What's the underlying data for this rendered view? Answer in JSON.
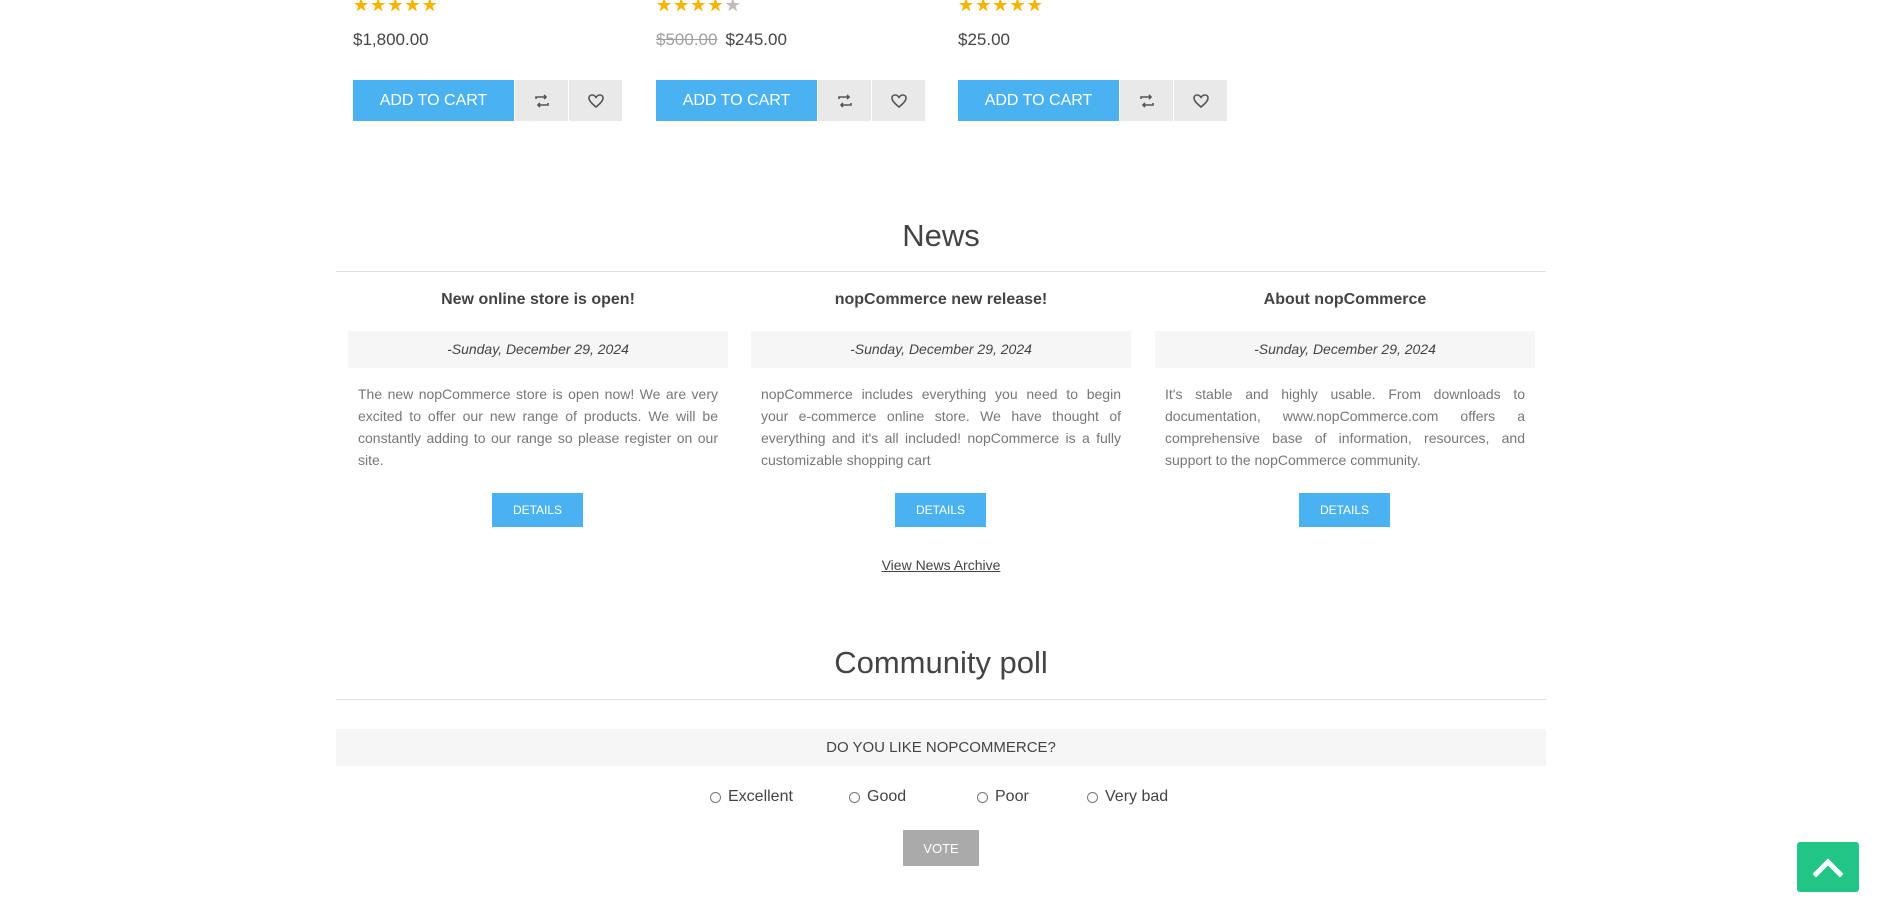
{
  "products": [
    {
      "rating": 5,
      "old_price": "",
      "price": "$1,800.00",
      "add_to_cart_label": "ADD TO CART"
    },
    {
      "rating": 4,
      "old_price": "$500.00",
      "price": "$245.00",
      "add_to_cart_label": "ADD TO CART"
    },
    {
      "rating": 5,
      "old_price": "",
      "price": "$25.00",
      "add_to_cart_label": "ADD TO CART"
    }
  ],
  "news": {
    "title": "News",
    "items": [
      {
        "title": "New online store is open!",
        "date": "-Sunday, December 29, 2024",
        "body": "The new nopCommerce store is open now! We are very excited to offer our new range of products. We will be constantly adding to our range so please register on our site.",
        "details_label": "DETAILS"
      },
      {
        "title": "nopCommerce new release!",
        "date": "-Sunday, December 29, 2024",
        "body": "nopCommerce includes everything you need to begin your e-commerce online store. We have thought of everything and it's all included! nopCommerce is a fully customizable shopping cart",
        "details_label": "DETAILS"
      },
      {
        "title": "About nopCommerce",
        "date": "-Sunday, December 29, 2024",
        "body": "It's stable and highly usable. From downloads to documentation, www.nopCommerce.com offers a comprehensive base of information, resources, and support to the nopCommerce community.",
        "details_label": "DETAILS"
      }
    ],
    "archive_link": "View News Archive"
  },
  "poll": {
    "title": "Community poll",
    "question": "DO YOU LIKE NOPCOMMERCE?",
    "options": [
      "Excellent",
      "Good",
      "Poor",
      "Very bad"
    ],
    "vote_label": "VOTE"
  },
  "colors": {
    "accent": "#4ab2f1",
    "scroll_top": "#21c585",
    "vote_button": "#aaaaaa"
  },
  "icons": {
    "compare": "compare-arrows-icon",
    "wishlist": "heart-icon",
    "scroll_top": "chevron-up-icon"
  }
}
